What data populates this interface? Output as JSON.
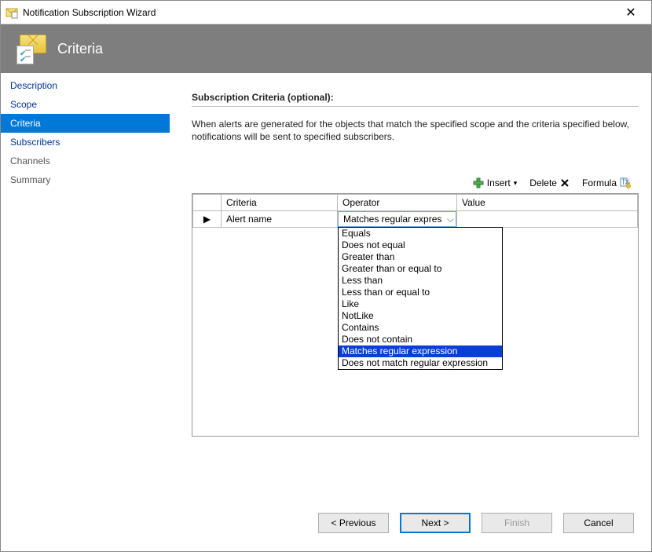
{
  "window": {
    "title": "Notification Subscription Wizard"
  },
  "header": {
    "page_title": "Criteria"
  },
  "sidebar": {
    "items": [
      {
        "label": "Description",
        "active": false,
        "muted": false
      },
      {
        "label": "Scope",
        "active": false,
        "muted": false
      },
      {
        "label": "Criteria",
        "active": true,
        "muted": false
      },
      {
        "label": "Subscribers",
        "active": false,
        "muted": false
      },
      {
        "label": "Channels",
        "active": false,
        "muted": true
      },
      {
        "label": "Summary",
        "active": false,
        "muted": true
      }
    ]
  },
  "main": {
    "section_title": "Subscription Criteria (optional):",
    "description": "When alerts are generated for the objects that match the specified scope and the criteria specified below, notifications will be sent to specified subscribers."
  },
  "toolbar": {
    "insert_label": "Insert",
    "delete_label": "Delete",
    "formula_label": "Formula"
  },
  "table": {
    "headers": {
      "criteria": "Criteria",
      "operator": "Operator",
      "value": "Value"
    },
    "row_marker": "▶",
    "rows": [
      {
        "criteria": "Alert name",
        "operator_selected": "Matches regular expression",
        "value": ""
      }
    ],
    "operator_options": [
      "Equals",
      "Does not equal",
      "Greater than",
      "Greater than or equal to",
      "Less than",
      "Less than or equal to",
      "Like",
      "NotLike",
      "Contains",
      "Does not contain",
      "Matches regular expression",
      "Does not match regular expression"
    ],
    "operator_selected_index": 10
  },
  "footer": {
    "previous_label": "< Previous",
    "next_label": "Next >",
    "finish_label": "Finish",
    "cancel_label": "Cancel"
  }
}
